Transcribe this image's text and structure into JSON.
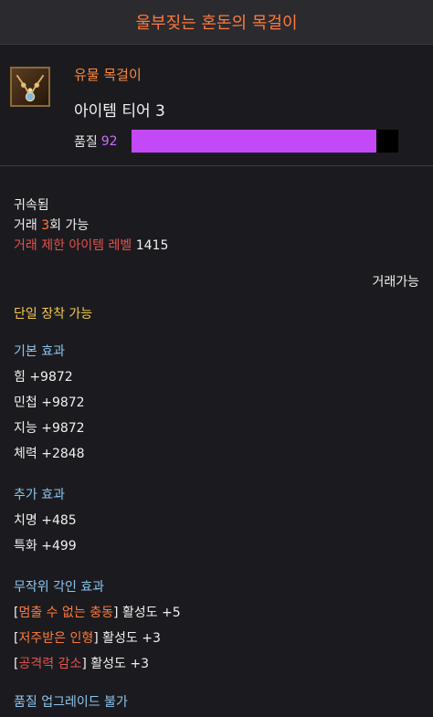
{
  "item": {
    "name": "울부짖는 혼돈의 목걸이",
    "grade": "유물 목걸이",
    "tier": "아이템 티어 3",
    "quality_label": "품질",
    "quality_value": "92",
    "quality_fraction": 0.92
  },
  "binding": {
    "bound": "귀속됨",
    "trade_prefix": "거래 ",
    "trade_count": "3",
    "trade_suffix": "회 가능",
    "trade_limit_label": "거래 제한 아이템 레벨",
    "trade_limit_value": " 1415",
    "tradable": "거래가능"
  },
  "equip": {
    "label": "단일 장착 가능"
  },
  "basic_effect": {
    "header": "기본 효과",
    "stats": [
      "힘 +9872",
      "민첩 +9872",
      "지능 +9872",
      "체력 +2848"
    ]
  },
  "additional_effect": {
    "header": "추가 효과",
    "stats": [
      "치명 +485",
      "특화 +499"
    ]
  },
  "engraving": {
    "header": "무작위 각인 효과",
    "items": [
      {
        "name": "멈출 수 없는 충동",
        "suffix": " 활성도 +5",
        "color": "#ff7a3c"
      },
      {
        "name": "저주받은 인형",
        "suffix": " 활성도 +3",
        "color": "#ff7a3c"
      },
      {
        "name": "공격력 감소",
        "suffix": " 활성도 +3",
        "color": "#e3524d"
      }
    ]
  },
  "footer": {
    "label": "품질 업그레이드 불가"
  }
}
